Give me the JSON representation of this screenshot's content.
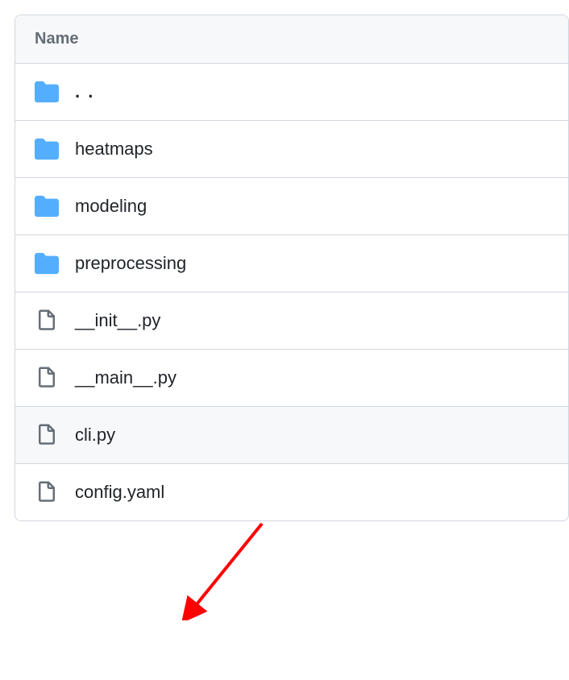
{
  "header": {
    "name_column": "Name"
  },
  "entries": [
    {
      "type": "parent",
      "label": ". ."
    },
    {
      "type": "folder",
      "label": "heatmaps"
    },
    {
      "type": "folder",
      "label": "modeling"
    },
    {
      "type": "folder",
      "label": "preprocessing"
    },
    {
      "type": "file",
      "label": "__init__.py"
    },
    {
      "type": "file",
      "label": "__main__.py"
    },
    {
      "type": "file",
      "label": "cli.py",
      "hovered": true
    },
    {
      "type": "file",
      "label": "config.yaml"
    }
  ],
  "annotation": {
    "arrow_color": "#ff0000"
  }
}
